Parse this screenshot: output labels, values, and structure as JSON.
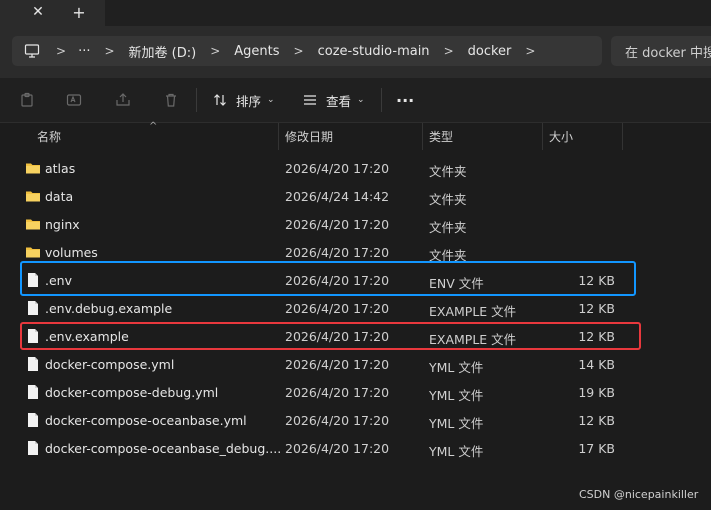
{
  "tabbar": {
    "close_label": "✕",
    "new_label": "+"
  },
  "address": {
    "crumbs": [
      "新加卷 (D:)",
      "Agents",
      "coze-studio-main",
      "docker"
    ],
    "more": "···",
    "search_placeholder": "在 docker 中搜索"
  },
  "toolbar": {
    "sort_label": "排序",
    "view_label": "查看",
    "more_label": "···"
  },
  "columns": {
    "name": "名称",
    "modified": "修改日期",
    "type": "类型",
    "size": "大小"
  },
  "files": [
    {
      "name": "atlas",
      "modified": "2026/4/20 17:20",
      "type": "文件夹",
      "size": "",
      "icon": "folder-icon"
    },
    {
      "name": "data",
      "modified": "2026/4/24 14:42",
      "type": "文件夹",
      "size": "",
      "icon": "folder-icon"
    },
    {
      "name": "nginx",
      "modified": "2026/4/20 17:20",
      "type": "文件夹",
      "size": "",
      "icon": "folder-icon"
    },
    {
      "name": "volumes",
      "modified": "2026/4/20 17:20",
      "type": "文件夹",
      "size": "",
      "icon": "folder-icon"
    },
    {
      "name": ".env",
      "modified": "2026/4/20 17:20",
      "type": "ENV 文件",
      "size": "12 KB",
      "icon": "file-icon"
    },
    {
      "name": ".env.debug.example",
      "modified": "2026/4/20 17:20",
      "type": "EXAMPLE 文件",
      "size": "12 KB",
      "icon": "file-icon"
    },
    {
      "name": ".env.example",
      "modified": "2026/4/20 17:20",
      "type": "EXAMPLE 文件",
      "size": "12 KB",
      "icon": "file-icon"
    },
    {
      "name": "docker-compose.yml",
      "modified": "2026/4/20 17:20",
      "type": "YML 文件",
      "size": "14 KB",
      "icon": "file-icon"
    },
    {
      "name": "docker-compose-debug.yml",
      "modified": "2026/4/20 17:20",
      "type": "YML 文件",
      "size": "19 KB",
      "icon": "file-icon"
    },
    {
      "name": "docker-compose-oceanbase.yml",
      "modified": "2026/4/20 17:20",
      "type": "YML 文件",
      "size": "12 KB",
      "icon": "file-icon"
    },
    {
      "name": "docker-compose-oceanbase_debug....",
      "modified": "2026/4/20 17:20",
      "type": "YML 文件",
      "size": "17 KB",
      "icon": "file-icon"
    }
  ],
  "watermark": "CSDN @nicepainkiller",
  "colors": {
    "background": "#1c1c1c",
    "highlight_blue": "#1296ff",
    "highlight_red": "#e8383d",
    "folder": "#f0c040"
  }
}
